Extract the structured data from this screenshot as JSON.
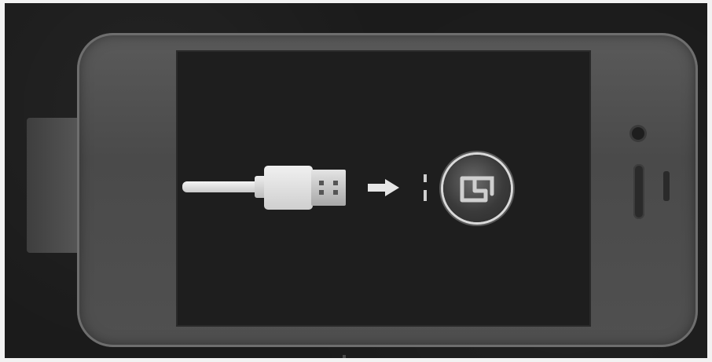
{
  "scene": {
    "description_visible_text": "",
    "icons": [
      "usb-cable-icon",
      "arrow-right-icon",
      "itunes-icon"
    ],
    "colors": {
      "background": "#1b1b1b",
      "phone_body": "#505050",
      "screen": "#1e1e1e",
      "cable": "#e8e8e8",
      "icon_ring": "#d9d9d9"
    }
  }
}
